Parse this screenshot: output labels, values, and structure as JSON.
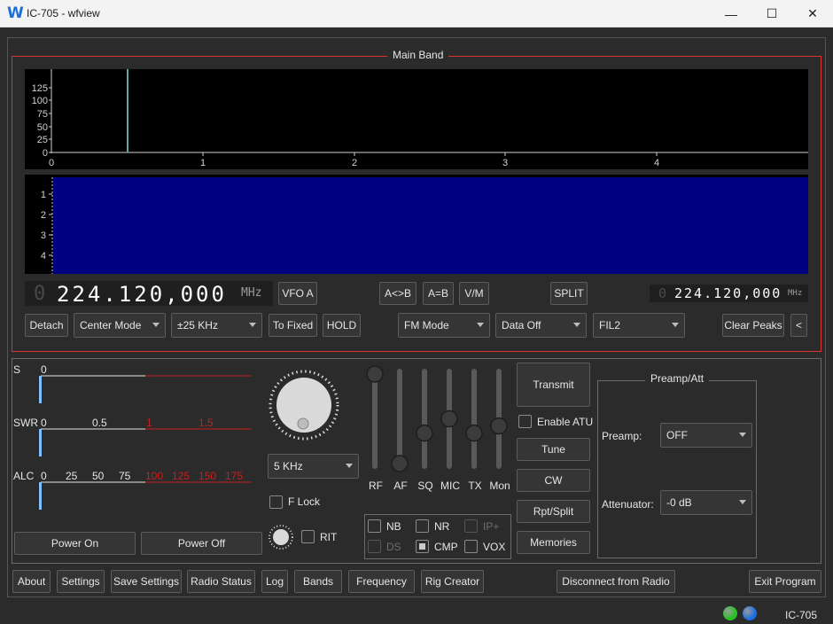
{
  "window": {
    "title": "IC-705 - wfview",
    "icon_letter": "W",
    "minimize_glyph": "—",
    "maximize_glyph": "☐",
    "close_glyph": "✕"
  },
  "main_band": {
    "title": "Main Band",
    "spectrum_y_ticks": [
      "125",
      "100",
      "75",
      "50",
      "25",
      "0"
    ],
    "spectrum_x_ticks": [
      "0",
      "1",
      "2",
      "3",
      "4"
    ],
    "waterfall_y_ticks": [
      "1",
      "2",
      "3",
      "4"
    ],
    "freq_main": {
      "prefix": "0",
      "value": "224.120,000",
      "unit": "MHz"
    },
    "freq_sub": {
      "prefix": "0",
      "value": "224.120,000",
      "unit": "MHz"
    },
    "vfo_a_label": "VFO A",
    "a_to_b_label": "A<>B",
    "a_eq_b_label": "A=B",
    "vm_label": "V/M",
    "split_label": "SPLIT",
    "detach_label": "Detach",
    "center_mode": "Center Mode",
    "span": "±25 KHz",
    "to_fixed_label": "To Fixed",
    "hold_label": "HOLD",
    "mode": "FM Mode",
    "data_mode": "Data Off",
    "filter": "FIL2",
    "clear_peaks_label": "Clear Peaks",
    "collapse_label": "<"
  },
  "meters": {
    "s": {
      "label": "S",
      "scale": [
        "0"
      ]
    },
    "swr": {
      "label": "SWR",
      "scale_white": [
        "0",
        "0.5"
      ],
      "scale_red": [
        "1",
        "1.5"
      ]
    },
    "alc": {
      "label": "ALC",
      "scale_white": [
        "0",
        "25",
        "50",
        "75"
      ],
      "scale_red": [
        "100",
        "125",
        "150",
        "175"
      ]
    }
  },
  "controls": {
    "tuning_step": "5 KHz",
    "f_lock_label": "F Lock",
    "rit_label": "RIT",
    "power_on_label": "Power On",
    "power_off_label": "Power Off"
  },
  "sliders": [
    {
      "label": "RF",
      "level": 0.0
    },
    {
      "label": "AF",
      "level": 1.0
    },
    {
      "label": "SQ",
      "level": 0.66
    },
    {
      "label": "MIC",
      "level": 0.5
    },
    {
      "label": "TX",
      "level": 0.66
    },
    {
      "label": "Mon",
      "level": 0.58
    }
  ],
  "features": {
    "nb": "NB",
    "nr": "NR",
    "ipplus": "IP+",
    "ds": "DS",
    "cmp": "CMP",
    "vox": "VOX"
  },
  "actions": {
    "transmit": "Transmit",
    "enable_atu": "Enable ATU",
    "tune": "Tune",
    "cw": "CW",
    "rpt_split": "Rpt/Split",
    "memories": "Memories"
  },
  "preamp_att": {
    "title": "Preamp/Att",
    "preamp_label": "Preamp:",
    "preamp_value": "OFF",
    "attenuator_label": "Attenuator:",
    "attenuator_value": "-0 dB"
  },
  "bottom_bar": {
    "about": "About",
    "settings": "Settings",
    "save_settings": "Save Settings",
    "radio_status": "Radio Status",
    "log": "Log",
    "bands": "Bands",
    "frequency": "Frequency",
    "rig_creator": "Rig Creator",
    "disconnect": "Disconnect from Radio",
    "exit": "Exit Program"
  },
  "status_bar": {
    "rig_name": "IC-705",
    "led_colors": [
      "#22c322",
      "#1a6fe0"
    ]
  }
}
